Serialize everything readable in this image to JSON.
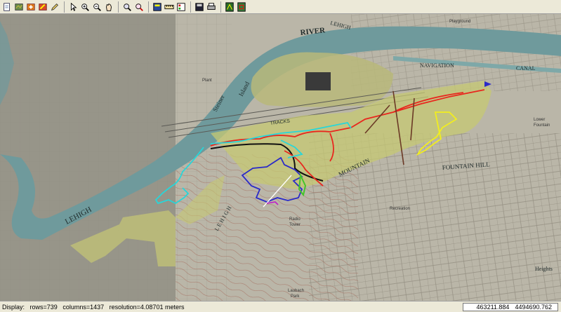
{
  "toolbar": {
    "groups": [
      [
        "new-file-icon",
        "open-map-icon",
        "add-layer-icon",
        "edit-layer-icon",
        "pencil-icon"
      ],
      [
        "pointer-icon",
        "zoom-in-icon",
        "zoom-out-icon",
        "pan-hand-icon"
      ],
      [
        "zoom-extent-icon",
        "zoom-previous-icon"
      ],
      [
        "query-icon",
        "measure-icon",
        "legend-icon"
      ],
      [
        "save-icon",
        "print-icon"
      ],
      [
        "map-view-icon",
        "overview-icon"
      ]
    ]
  },
  "map": {
    "labels": {
      "river": "RIVER",
      "lehigh_river_top": "LEHIGH",
      "navigation": "NAVIGATION",
      "canal": "CANAL",
      "steiner": "Steiner",
      "island": "Island",
      "tracks": "TRACKS",
      "fountain_hill": "FOUNTAIN HILL",
      "mountain": "MOUNTAIN",
      "lehigh_bottom": "LEHIGH",
      "lehigh_diag": "L E H I G H",
      "playground": "Playground",
      "radio": "Radio",
      "tower": "Tower",
      "recreation": "Recreation",
      "heights": "Heights",
      "laubach": "Laubach",
      "park": "Park",
      "lower": "Lower",
      "fountain": "Fountain",
      "plant": "Plant"
    },
    "colors": {
      "river": "#6f9a9c",
      "parcel": "#c6c873",
      "trail_red": "#e8271e",
      "trail_black": "#101010",
      "trail_cyan": "#27d6d9",
      "trail_blue": "#2a2ac8",
      "trail_yellow": "#f2ee1e",
      "trail_green": "#45c42a",
      "trail_brown": "#6b3a26",
      "trail_white": "#ffffff",
      "trail_magenta": "#c01ec8"
    }
  },
  "status": {
    "display": "Display:",
    "rows": "rows=739",
    "columns": "columns=1437",
    "resolution": "resolution=4.08701 meters",
    "x": "463211.884",
    "y": "4494690.762"
  }
}
